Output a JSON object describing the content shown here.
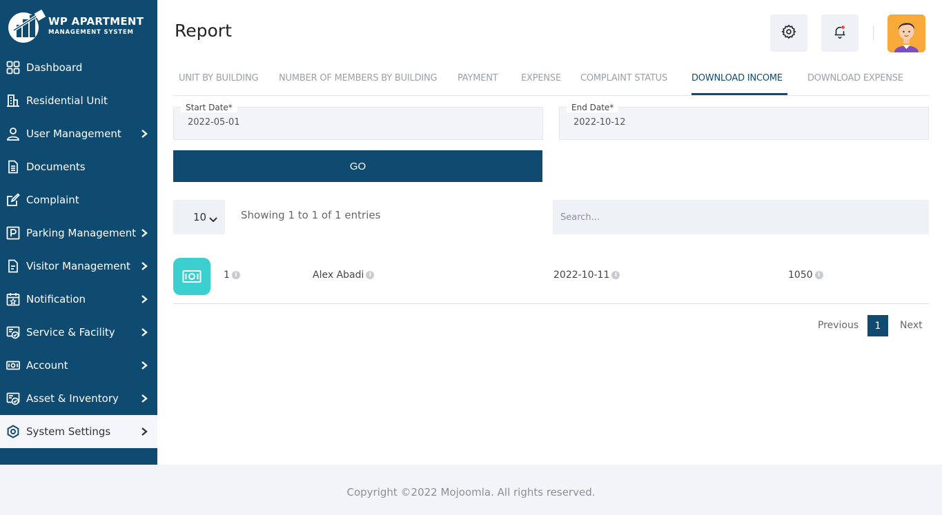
{
  "brand": {
    "title": "WP APARTMENT",
    "subtitle": "MANAGEMENT SYSTEM"
  },
  "sidebar": {
    "items": [
      {
        "label": "Dashboard",
        "icon": "grid-icon",
        "has_submenu": false
      },
      {
        "label": "Residential Unit",
        "icon": "building-icon",
        "has_submenu": false
      },
      {
        "label": "User Management",
        "icon": "user-icon",
        "has_submenu": true
      },
      {
        "label": "Documents",
        "icon": "document-icon",
        "has_submenu": false
      },
      {
        "label": "Complaint",
        "icon": "edit-icon",
        "has_submenu": false
      },
      {
        "label": "Parking Management",
        "icon": "parking-icon",
        "has_submenu": true
      },
      {
        "label": "Visitor Management",
        "icon": "visitor-doc-icon",
        "has_submenu": true
      },
      {
        "label": "Notification",
        "icon": "calendar-star-icon",
        "has_submenu": true
      },
      {
        "label": "Service & Facility",
        "icon": "service-icon",
        "has_submenu": true
      },
      {
        "label": "Account",
        "icon": "money-icon",
        "has_submenu": true
      },
      {
        "label": "Asset & Inventory",
        "icon": "asset-icon",
        "has_submenu": true
      },
      {
        "label": "System Settings",
        "icon": "settings-icon",
        "has_submenu": true,
        "active": true
      }
    ]
  },
  "header": {
    "title": "Report"
  },
  "tabs": [
    {
      "label": "UNIT BY BUILDING"
    },
    {
      "label": "NUMBER OF MEMBERS BY BUILDING"
    },
    {
      "label": "PAYMENT"
    },
    {
      "label": "EXPENSE"
    },
    {
      "label": "COMPLAINT STATUS"
    },
    {
      "label": "DOWNLOAD INCOME",
      "active": true
    },
    {
      "label": "DOWNLOAD EXPENSE"
    }
  ],
  "filters": {
    "start_label": "Start Date*",
    "start_value": "2022-05-01",
    "end_label": "End Date*",
    "end_value": "2022-10-12",
    "go_label": "GO"
  },
  "table_controls": {
    "page_length": "10",
    "info": "Showing 1 to 1 of 1 entries",
    "search_placeholder": "Search..."
  },
  "rows": [
    {
      "id": "1",
      "name": "Alex Abadi",
      "date": "2022-10-11",
      "amount": "1050"
    }
  ],
  "pagination": {
    "previous": "Previous",
    "current": "1",
    "next": "Next"
  },
  "footer": {
    "copyright": "Copyright ©2022 Mojoomla. All rights reserved."
  },
  "colors": {
    "primary": "#0f4a70",
    "accent": "#3ccfcf",
    "notification_dot": "#e74c3c"
  }
}
